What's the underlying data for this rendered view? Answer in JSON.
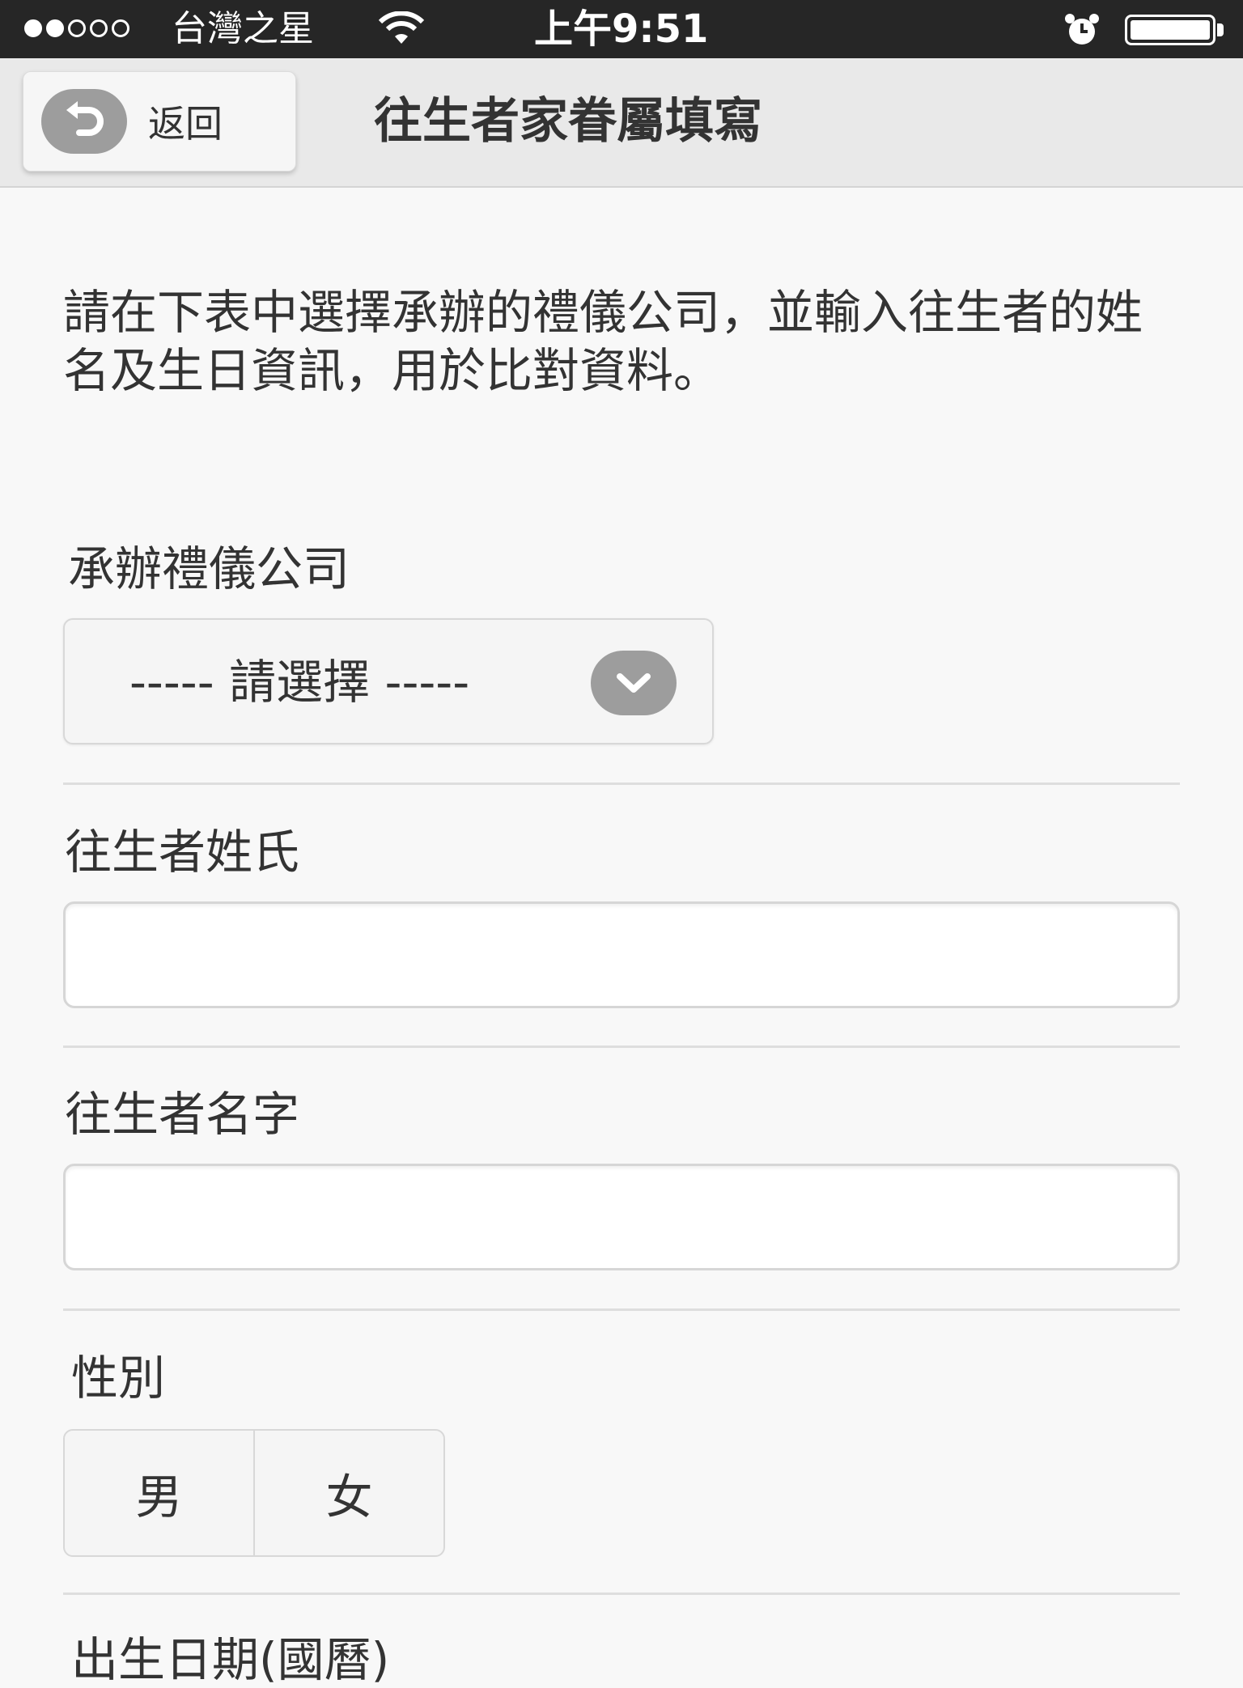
{
  "status_bar": {
    "carrier": "台灣之星",
    "time": "上午9:51"
  },
  "header": {
    "back_label": "返回",
    "title": "往生者家眷屬填寫"
  },
  "intro_text": "請在下表中選擇承辦的禮儀公司，並輸入往生者的姓名及生日資訊，用於比對資料。",
  "form": {
    "company_label": "承辦禮儀公司",
    "company_select_value": "----- 請選擇 -----",
    "surname_label": "往生者姓氏",
    "surname_value": "",
    "given_name_label": "往生者名字",
    "given_name_value": "",
    "gender_label": "性別",
    "gender_options": [
      "男",
      "女"
    ],
    "birthdate_label": "出生日期(國曆)"
  }
}
